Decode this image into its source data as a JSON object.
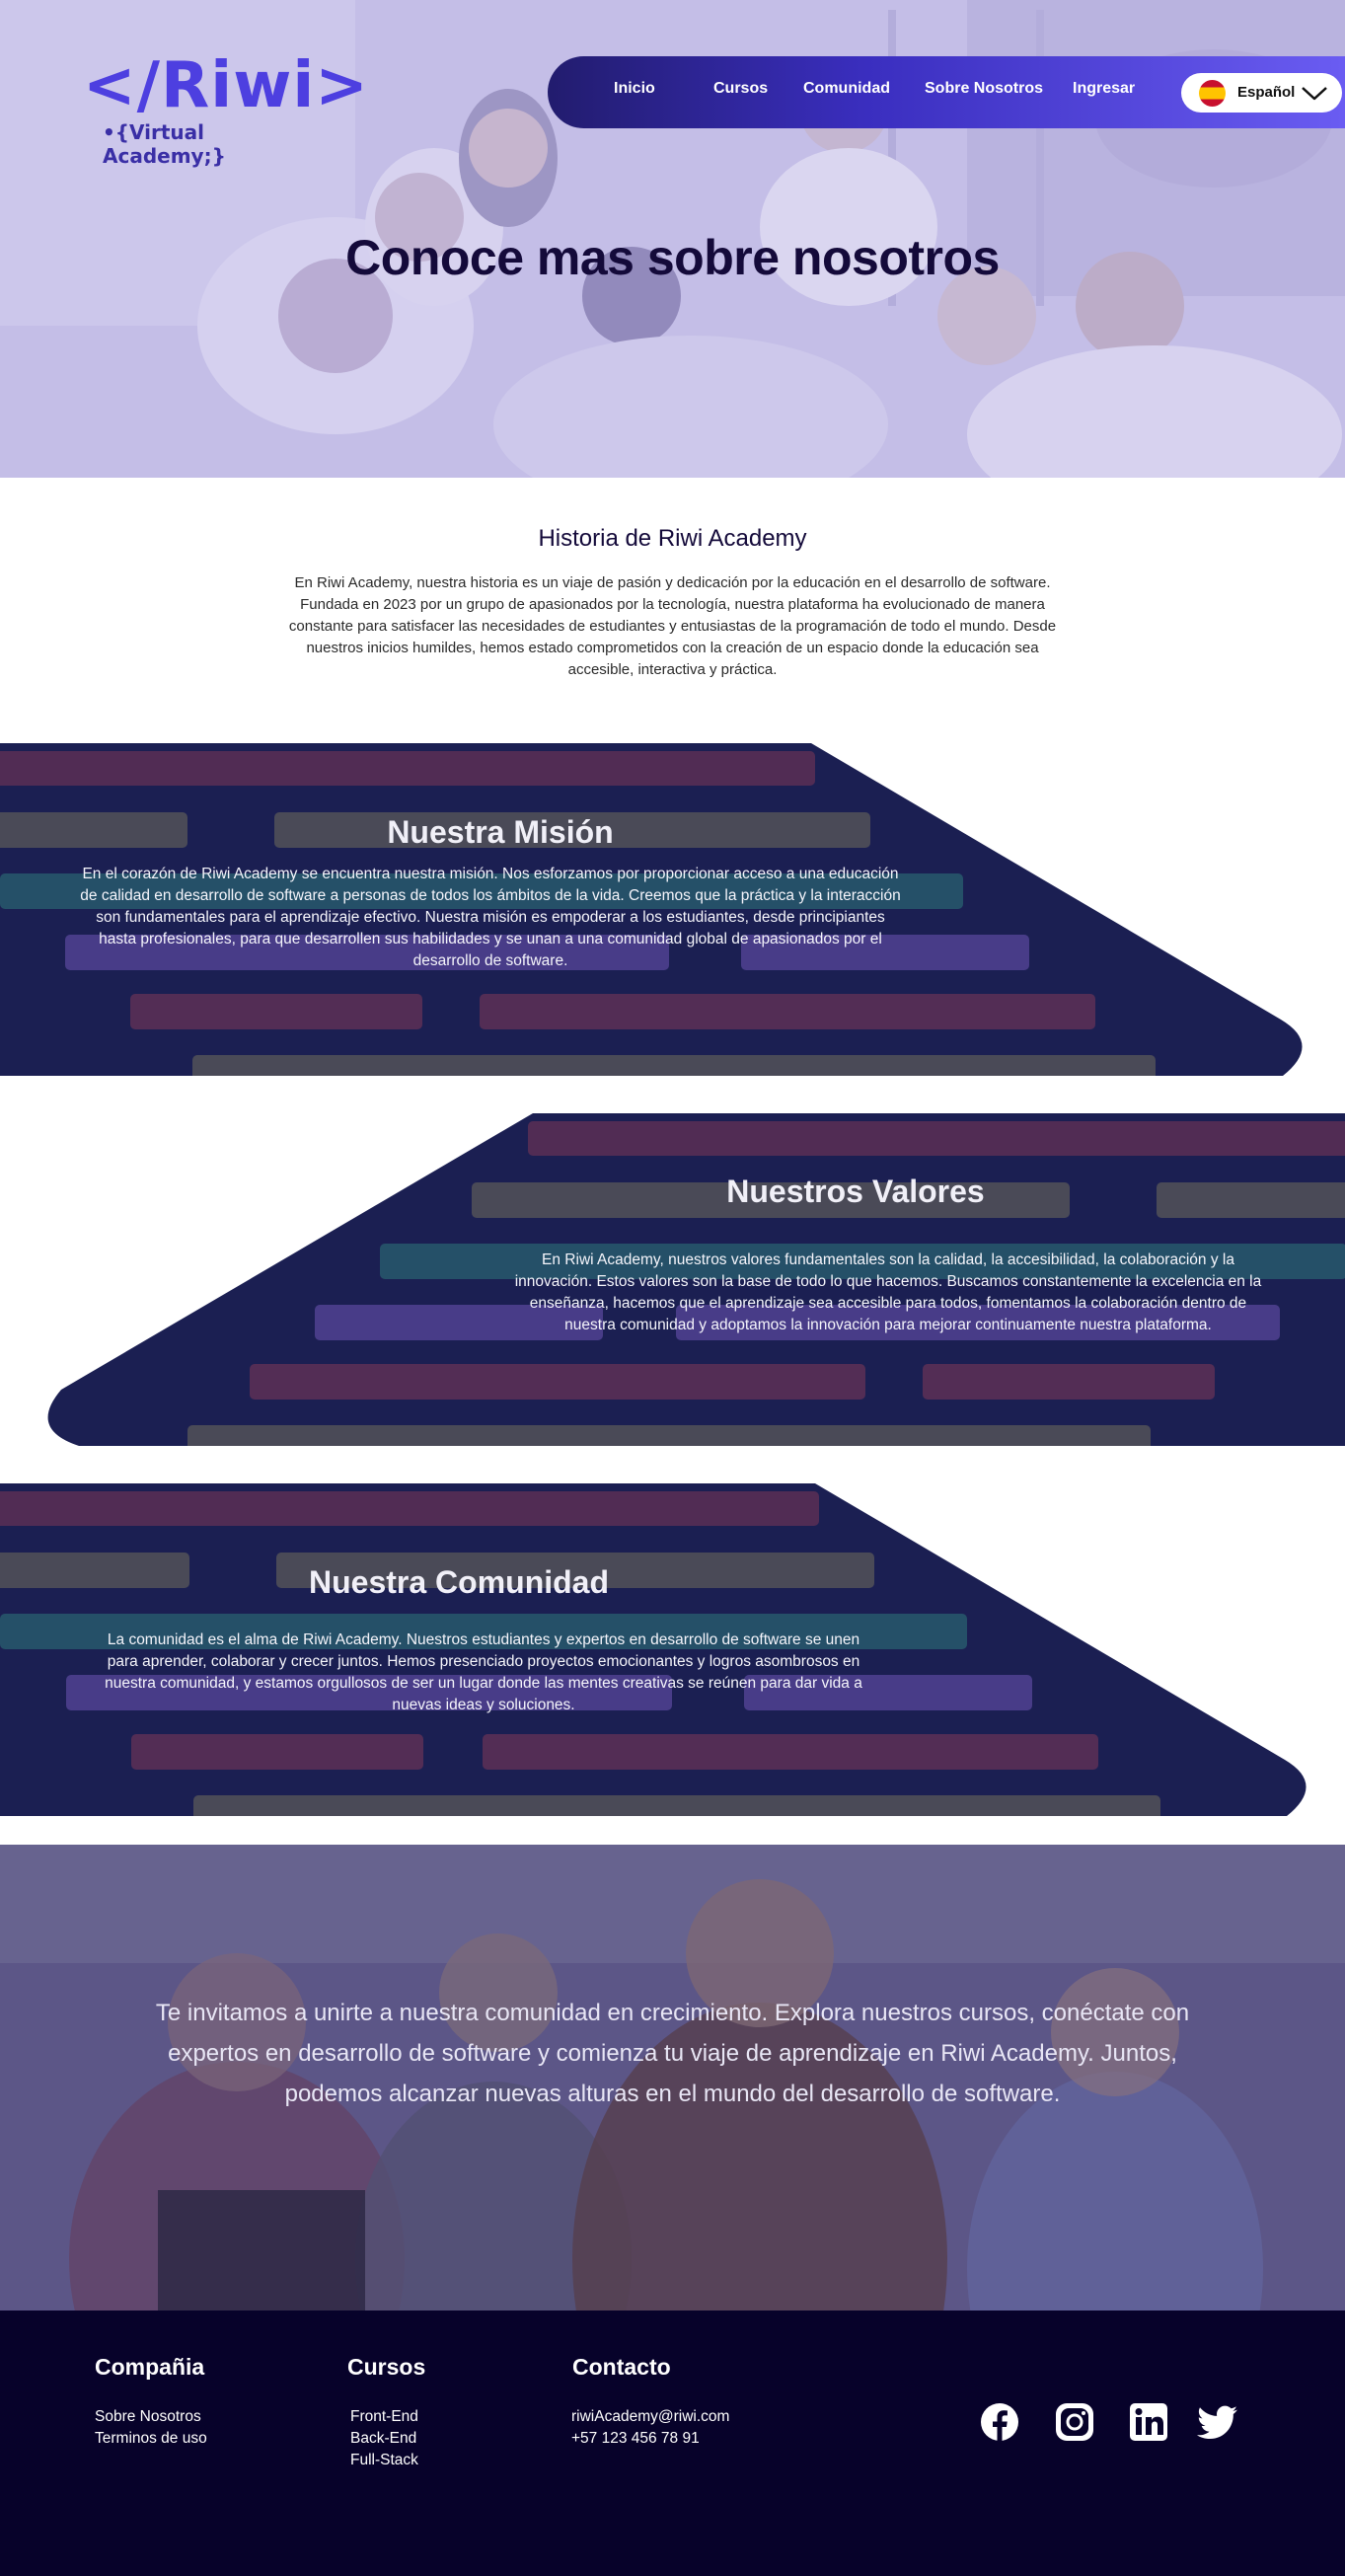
{
  "nav": {
    "logo_main": "</Riwi>",
    "logo_sub": "•{Virtual Academy;}",
    "items": [
      {
        "label": "Inicio"
      },
      {
        "label": "Cursos"
      },
      {
        "label": "Comunidad"
      },
      {
        "label": "Sobre Nosotros"
      },
      {
        "label": "Ingresar"
      }
    ],
    "language": {
      "label": "Español",
      "icon": "spain-flag-icon"
    }
  },
  "hero": {
    "title": "Conoce mas sobre nosotros"
  },
  "historia": {
    "title": "Historia de Riwi Academy",
    "text": "En Riwi Academy, nuestra historia es un viaje de pasión y dedicación por la educación en el desarrollo de software. Fundada en 2023 por un grupo de apasionados por la tecnología, nuestra plataforma ha evolucionado de manera constante para satisfacer las necesidades de estudiantes y entusiastas de la programación de todo el mundo. Desde nuestros inicios humildes, hemos estado comprometidos con la creación de un espacio donde la educación sea accesible, interactiva y práctica."
  },
  "mision": {
    "title": "Nuestra Misión",
    "text": "En el corazón de Riwi Academy se encuentra nuestra misión. Nos esforzamos por proporcionar acceso a una educación de calidad en desarrollo de software a personas de todos los ámbitos de la vida. Creemos que la práctica y la interacción son fundamentales para el aprendizaje efectivo. Nuestra misión es empoderar a los estudiantes, desde principiantes hasta profesionales, para que desarrollen sus habilidades y se unan a una comunidad global de apasionados por el desarrollo de software."
  },
  "valores": {
    "title": "Nuestros Valores",
    "text": "En Riwi Academy, nuestros valores fundamentales son la calidad, la accesibilidad, la colaboración y la innovación. Estos valores son la base de todo lo que hacemos. Buscamos constantemente la excelencia en la enseñanza, hacemos que el aprendizaje sea accesible para todos, fomentamos la colaboración dentro de nuestra comunidad y adoptamos la innovación para mejorar continuamente nuestra plataforma."
  },
  "comunidad": {
    "title": "Nuestra Comunidad",
    "text": "La comunidad es el alma de Riwi Academy. Nuestros estudiantes y expertos en desarrollo de software se unen para aprender, colaborar y crecer juntos. Hemos presenciado proyectos emocionantes y logros asombrosos en nuestra comunidad, y estamos orgullosos de ser un lugar donde las mentes creativas se reúnen para dar vida a nuevas ideas y soluciones."
  },
  "invite": {
    "text": "Te invitamos a unirte a nuestra comunidad en crecimiento. Explora nuestros cursos, conéctate con expertos en desarrollo de software y comienza tu viaje de aprendizaje en Riwi Academy. Juntos, podemos alcanzar nuevas alturas en el mundo del desarrollo de software."
  },
  "footer": {
    "company": {
      "title": "Compañia",
      "links": [
        "Sobre Nosotros",
        "Terminos de uso"
      ]
    },
    "courses": {
      "title": "Cursos",
      "links": [
        "Front-End",
        "Back-End",
        "Full-Stack"
      ]
    },
    "contact": {
      "title": "Contacto",
      "email": "riwiAcademy@riwi.com",
      "phone": "+57 123 456 78 91"
    },
    "social": [
      "facebook-icon",
      "instagram-icon",
      "linkedin-icon",
      "twitter-icon"
    ]
  },
  "colors": {
    "brand": "#4d3fe0",
    "band": "#1b1f52",
    "footer": "#07022a",
    "title_dark": "#140a3a"
  }
}
